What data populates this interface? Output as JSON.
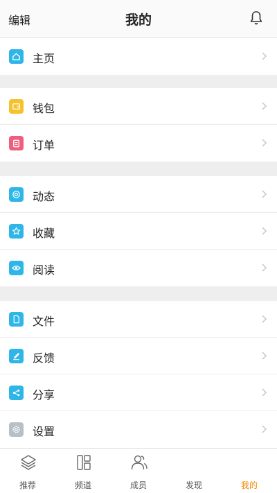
{
  "header": {
    "edit": "编辑",
    "title": "我的"
  },
  "groups": [
    {
      "items": [
        {
          "label": "主页",
          "icon": "home-icon",
          "color": "#2fb6e9"
        }
      ]
    },
    {
      "items": [
        {
          "label": "钱包",
          "icon": "wallet-icon",
          "color": "#f6c12b"
        },
        {
          "label": "订单",
          "icon": "clipboard-icon",
          "color": "#ef5f7d"
        }
      ]
    },
    {
      "items": [
        {
          "label": "动态",
          "icon": "at-icon",
          "color": "#2fb6e9"
        },
        {
          "label": "收藏",
          "icon": "star-icon",
          "color": "#2fb6e9"
        },
        {
          "label": "阅读",
          "icon": "eye-icon",
          "color": "#2fb6e9"
        }
      ]
    },
    {
      "items": [
        {
          "label": "文件",
          "icon": "file-icon",
          "color": "#2fb6e9"
        },
        {
          "label": "反馈",
          "icon": "pencil-icon",
          "color": "#2fb6e9"
        },
        {
          "label": "分享",
          "icon": "share-icon",
          "color": "#2fb6e9"
        },
        {
          "label": "设置",
          "icon": "gear-icon",
          "color": "#b7c0c7"
        }
      ]
    }
  ],
  "tabs": [
    {
      "label": "推荐",
      "icon": "layers-icon"
    },
    {
      "label": "频道",
      "icon": "grid-icon"
    },
    {
      "label": "成员",
      "icon": "members-icon"
    },
    {
      "label": "发现",
      "icon": "compass-icon"
    },
    {
      "label": "我的",
      "icon": "profile-icon",
      "active": true
    }
  ],
  "colors": {
    "accent": "#f08c00",
    "divider": "#eeeeee"
  }
}
